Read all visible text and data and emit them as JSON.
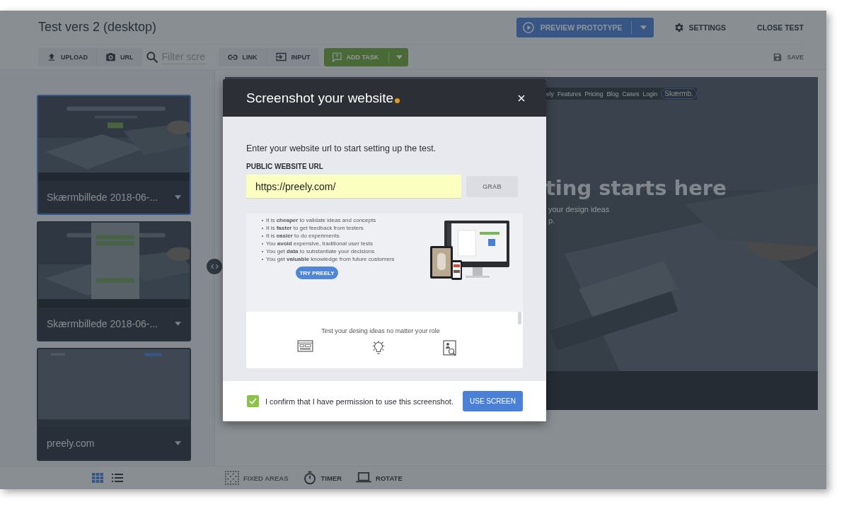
{
  "header": {
    "title": "Test vers 2 (desktop)",
    "preview_button": "PREVIEW PROTOTYPE",
    "settings_button": "SETTINGS",
    "close_button": "CLOSE TEST"
  },
  "toolbar": {
    "upload_button": "UPLOAD",
    "url_button": "URL",
    "filter": {
      "placeholder": "Filter scre"
    },
    "link_button": "LINK",
    "input_button": "INPUT",
    "add_task_button": "ADD TASK",
    "save": {
      "label": "SAVE",
      "disabled": true
    }
  },
  "screens": [
    {
      "name": "Skærmbillede 2018-06-...",
      "selected": true
    },
    {
      "name": "Skærmbillede 2018-06-...",
      "selected": false
    },
    {
      "name": "preely.com",
      "selected": false
    }
  ],
  "view_toggle": [
    {
      "kind": "grid",
      "selected": true
    },
    {
      "kind": "list",
      "selected": false
    }
  ],
  "canvas": {
    "nav": [
      "ely",
      "Features",
      "Pricing",
      "Blog",
      "Cases",
      "Login"
    ],
    "chip": "Skærmb.",
    "headline": "ting starts here",
    "subline": "your design ideas",
    "subline_2": "p."
  },
  "bottom_tools": [
    {
      "kind": "fixed_areas",
      "label": "FIXED AREAS",
      "disabled": true
    },
    {
      "kind": "timer",
      "label": "TIMER",
      "disabled": false
    },
    {
      "kind": "rotate",
      "label": "ROTATE",
      "disabled": false
    }
  ],
  "dialog": {
    "title": "Screenshot your website",
    "intro": "Enter your website url to start setting up the test.",
    "url_label": "PUBLIC WEBSITE URL",
    "url_value": "https://preely.com/",
    "grab": {
      "label": "GRAB",
      "disabled": true
    },
    "preview": {
      "bullets": [
        "It is **cheaper** to validate ideas and concepts",
        "It is **faster** to get feedback from testers",
        "It is **easier** to do experiments",
        "You **avoid** expensive, traditional user tests",
        "You get **data** to substantiate your decisions",
        "You get **valuable** knowledge from future customers"
      ],
      "try_button": "TRY PREELY",
      "tagline": "Test your desing ideas no matter your role"
    },
    "confirm": {
      "label": "I confirm that I have permission to use this screenshot.",
      "checked": true
    },
    "use_button": "USE SCREEN"
  }
}
